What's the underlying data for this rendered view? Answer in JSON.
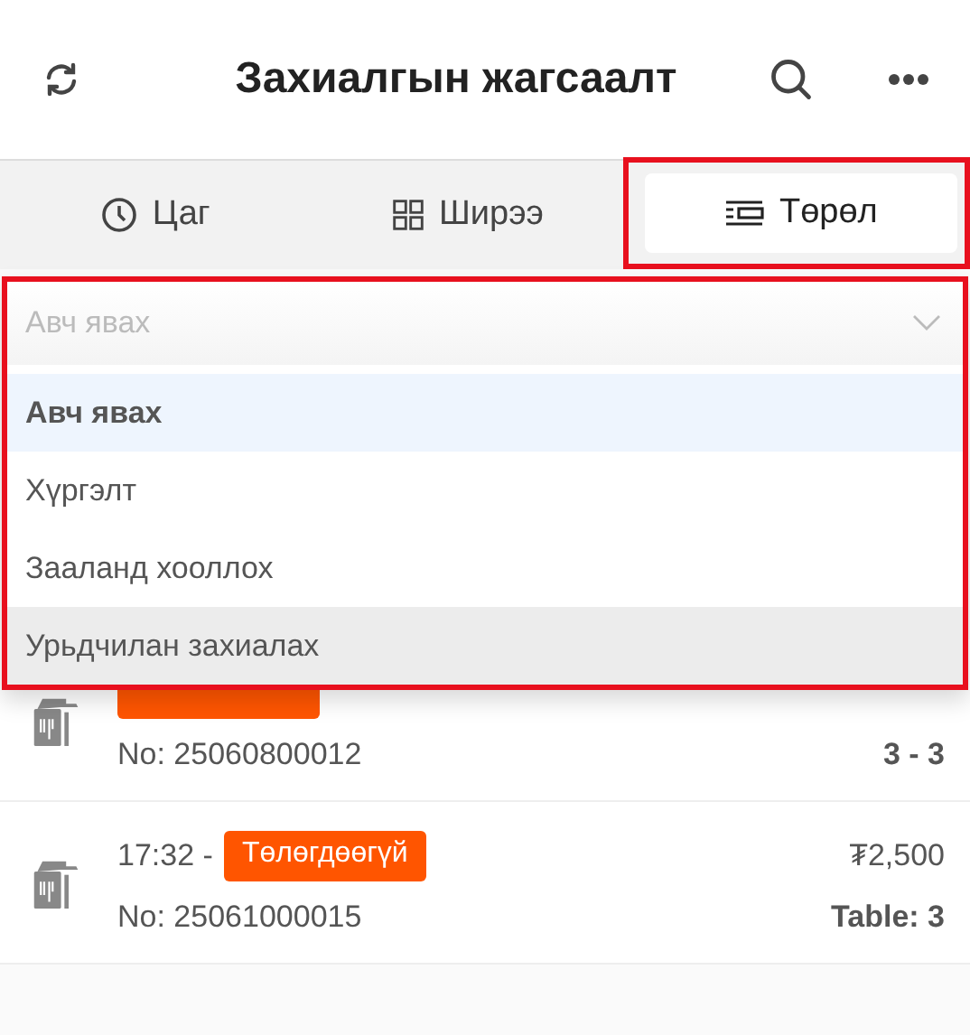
{
  "header": {
    "title": "Захиалгын жагсаалт"
  },
  "tabs": [
    {
      "label": "Цаг",
      "selected": false
    },
    {
      "label": "Ширээ",
      "selected": false
    },
    {
      "label": "Төрөл",
      "selected": true
    }
  ],
  "type_dropdown": {
    "placeholder": "Авч явах",
    "expanded": true,
    "options": [
      {
        "label": "Авч явах",
        "selected": true,
        "hovered": false
      },
      {
        "label": "Хүргэлт",
        "selected": false,
        "hovered": false
      },
      {
        "label": "Зааланд хооллох",
        "selected": false,
        "hovered": false
      },
      {
        "label": "Урьдчилан захиалах",
        "selected": false,
        "hovered": true
      }
    ]
  },
  "orders": [
    {
      "number": "No: 25060800012",
      "table": "3 - 3",
      "status_tag": {
        "kind": "unpaid"
      }
    },
    {
      "time": "17:32 -",
      "number": "No: 25061000015",
      "price": "₮2,500",
      "table": "Table: 3",
      "status_tag": {
        "kind": "unpaid",
        "label": "Төлөгдөөгүй"
      }
    }
  ]
}
